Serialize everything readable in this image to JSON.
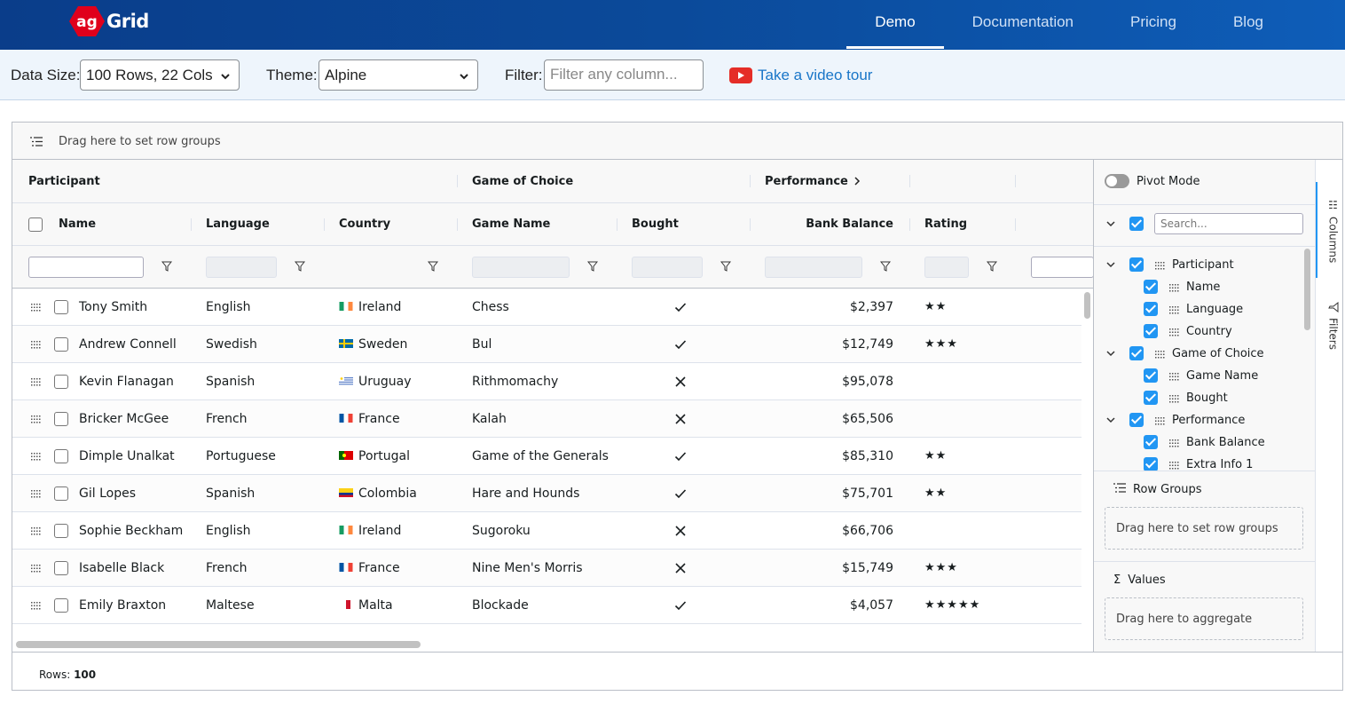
{
  "nav": {
    "logo_ag": "ag",
    "logo_grid": "Grid",
    "links": [
      "Demo",
      "Documentation",
      "Pricing",
      "Blog"
    ]
  },
  "toolbar": {
    "data_size_label": "Data Size:",
    "data_size_value": "100 Rows, 22 Cols",
    "theme_label": "Theme:",
    "theme_value": "Alpine",
    "filter_label": "Filter:",
    "filter_placeholder": "Filter any column...",
    "video_label": "Take a video tour"
  },
  "grid": {
    "row_group_hint": "Drag here to set row groups",
    "groups": [
      "Participant",
      "Game of Choice",
      "Performance"
    ],
    "columns": [
      "Name",
      "Language",
      "Country",
      "Game Name",
      "Bought",
      "Bank Balance",
      "Rating"
    ],
    "rows": [
      {
        "name": "Tony Smith",
        "language": "English",
        "country": "Ireland",
        "flag": "ie",
        "game": "Chess",
        "bought": true,
        "balance": "$2,397",
        "rating": "★★"
      },
      {
        "name": "Andrew Connell",
        "language": "Swedish",
        "country": "Sweden",
        "flag": "se",
        "game": "Bul",
        "bought": true,
        "balance": "$12,749",
        "rating": "★★★"
      },
      {
        "name": "Kevin Flanagan",
        "language": "Spanish",
        "country": "Uruguay",
        "flag": "uy",
        "game": "Rithmomachy",
        "bought": false,
        "balance": "$95,078",
        "rating": ""
      },
      {
        "name": "Bricker McGee",
        "language": "French",
        "country": "France",
        "flag": "fr",
        "game": "Kalah",
        "bought": false,
        "balance": "$65,506",
        "rating": ""
      },
      {
        "name": "Dimple Unalkat",
        "language": "Portuguese",
        "country": "Portugal",
        "flag": "pt",
        "game": "Game of the Generals",
        "bought": true,
        "balance": "$85,310",
        "rating": "★★"
      },
      {
        "name": "Gil Lopes",
        "language": "Spanish",
        "country": "Colombia",
        "flag": "co",
        "game": "Hare and Hounds",
        "bought": true,
        "balance": "$75,701",
        "rating": "★★"
      },
      {
        "name": "Sophie Beckham",
        "language": "English",
        "country": "Ireland",
        "flag": "ie",
        "game": "Sugoroku",
        "bought": false,
        "balance": "$66,706",
        "rating": ""
      },
      {
        "name": "Isabelle Black",
        "language": "French",
        "country": "France",
        "flag": "fr",
        "game": "Nine Men's Morris",
        "bought": false,
        "balance": "$15,749",
        "rating": "★★★"
      },
      {
        "name": "Emily Braxton",
        "language": "Maltese",
        "country": "Malta",
        "flag": "mt",
        "game": "Blockade",
        "bought": true,
        "balance": "$4,057",
        "rating": "★★★★★"
      }
    ],
    "footer_label": "Rows:",
    "footer_count": "100"
  },
  "side": {
    "pivot_label": "Pivot Mode",
    "search_placeholder": "Search...",
    "tree": [
      {
        "label": "Participant",
        "level": 0
      },
      {
        "label": "Name",
        "level": 1
      },
      {
        "label": "Language",
        "level": 1
      },
      {
        "label": "Country",
        "level": 1
      },
      {
        "label": "Game of Choice",
        "level": 0
      },
      {
        "label": "Game Name",
        "level": 1
      },
      {
        "label": "Bought",
        "level": 1
      },
      {
        "label": "Performance",
        "level": 0
      },
      {
        "label": "Bank Balance",
        "level": 1
      },
      {
        "label": "Extra Info 1",
        "level": 1
      }
    ],
    "row_groups_title": "Row Groups",
    "row_groups_hint": "Drag here to set row groups",
    "values_title": "Values",
    "values_hint": "Drag here to aggregate",
    "tab_columns": "Columns",
    "tab_filters": "Filters"
  },
  "colors": {
    "nav_bg": "#0b4a9a",
    "accent": "#2196f3",
    "link": "#1976c8"
  }
}
